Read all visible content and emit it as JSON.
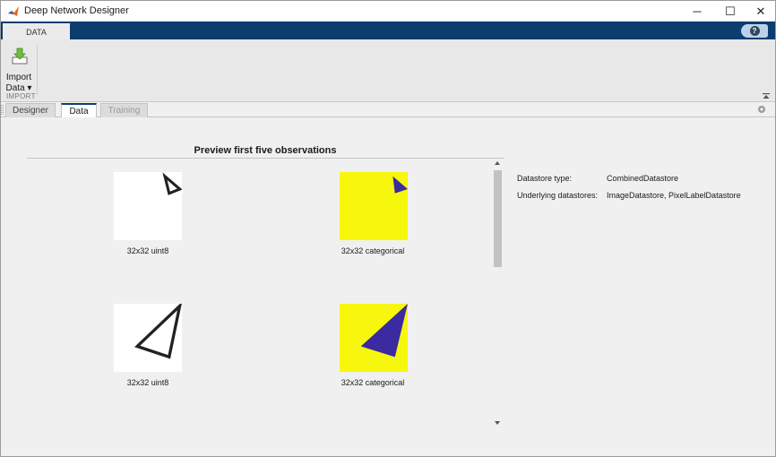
{
  "window": {
    "title": "Deep Network Designer",
    "minimize_glyph": "─",
    "maximize_glyph": "☐",
    "close_glyph": "✕"
  },
  "ribbon": {
    "tab_label": "DATA",
    "help_glyph": "?",
    "import_button": {
      "label_line1": "Import",
      "label_line2": "Data ▾",
      "icon": "import-data-icon"
    },
    "group_label": "IMPORT"
  },
  "doc_tabs": [
    {
      "label": "Designer"
    },
    {
      "label": "Data"
    },
    {
      "label": "Training"
    }
  ],
  "preview": {
    "title": "Preview first five observations",
    "observations": [
      {
        "input_caption": "32x32 uint8",
        "label_caption": "32x32 categorical"
      },
      {
        "input_caption": "32x32 uint8",
        "label_caption": "32x32 categorical"
      }
    ]
  },
  "info": {
    "datastore_type_label": "Datastore type:",
    "datastore_type_value": "CombinedDatastore",
    "underlying_label": "Underlying datastores:",
    "underlying_value": "ImageDatastore, PixelLabelDatastore"
  },
  "colors": {
    "ribbon_blue": "#0d3c6e",
    "label_yellow": "#f7f70e",
    "label_purple": "#3b2aa0"
  }
}
